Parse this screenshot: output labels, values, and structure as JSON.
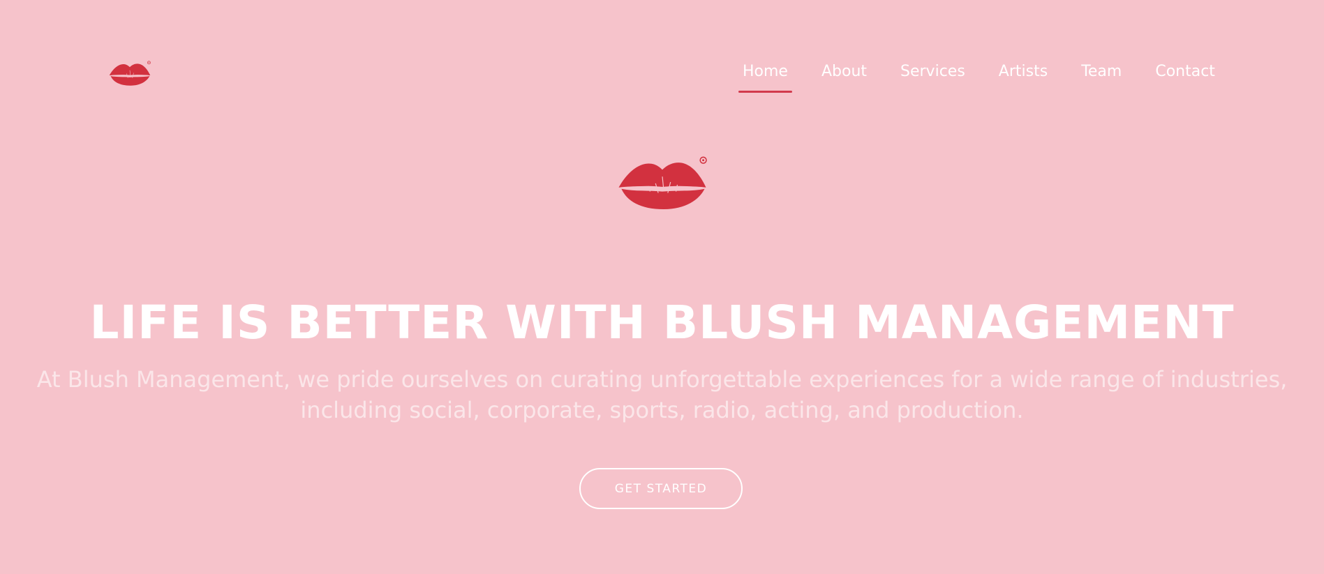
{
  "brand": {
    "logo_icon": "red-lips-logo-icon"
  },
  "nav": {
    "items": [
      {
        "label": "Home",
        "active": true
      },
      {
        "label": "About",
        "active": false
      },
      {
        "label": "Services",
        "active": false
      },
      {
        "label": "Artists",
        "active": false
      },
      {
        "label": "Team",
        "active": false
      },
      {
        "label": "Contact",
        "active": false
      }
    ]
  },
  "hero": {
    "logo_icon": "red-lips-logo-icon",
    "headline": "LIFE IS BETTER WITH BLUSH MANAGEMENT",
    "subtitle": "At Blush Management, we pride ourselves on curating unforgettable experiences for a wide range of industries, including social, corporate, sports, radio, acting, and production.",
    "cta_label": "GET STARTED"
  },
  "colors": {
    "background": "#f6c3cb",
    "accent": "#d23a4c",
    "text": "#ffffff",
    "subtitle_text": "#fbe6e9"
  }
}
